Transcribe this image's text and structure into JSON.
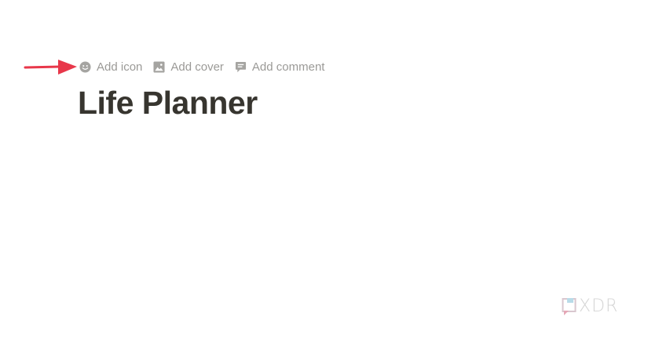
{
  "page_actions": {
    "add_icon": {
      "label": "Add icon",
      "icon": "smiley-icon"
    },
    "add_cover": {
      "label": "Add cover",
      "icon": "image-icon"
    },
    "add_comment": {
      "label": "Add comment",
      "icon": "comment-icon"
    }
  },
  "page": {
    "title": "Life Planner"
  },
  "annotation": {
    "arrow_color": "#e8374a"
  },
  "watermark": {
    "text": "XDR",
    "logo": "xda-logo"
  }
}
